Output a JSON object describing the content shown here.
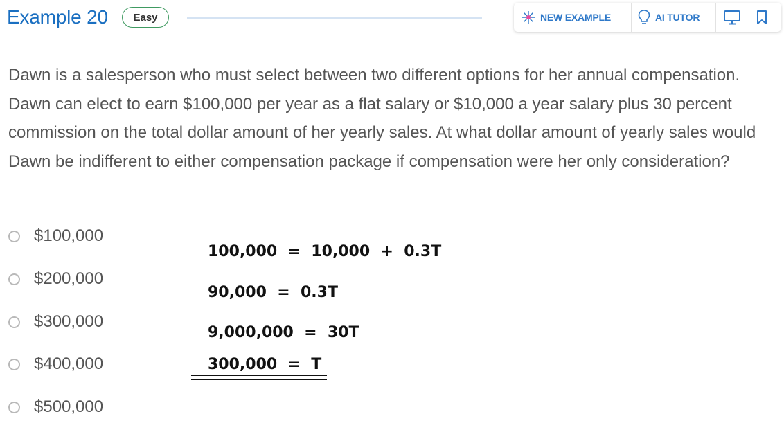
{
  "header": {
    "title": "Example 20",
    "difficulty_badge": "Easy",
    "toolbar": {
      "new_example_label": "NEW EXAMPLE",
      "ai_tutor_label": "AI TUTOR",
      "icons": [
        "sparkle-icon",
        "lightbulb-icon",
        "monitor-icon",
        "bookmark-icon"
      ]
    }
  },
  "question": {
    "text": "Dawn is a salesperson who must select between two different options for her annual compensation. Dawn can elect to earn $100,000 per year as a flat salary or $10,000 a year salary plus 30 percent commission on the total dollar amount of her yearly sales. At what dollar amount of yearly sales would Dawn be indifferent to either compensation package if compensation were her only consideration?"
  },
  "options": [
    {
      "label": "$100,000"
    },
    {
      "label": "$200,000"
    },
    {
      "label": "$300,000"
    },
    {
      "label": "$400,000"
    },
    {
      "label": "$500,000"
    }
  ],
  "work": {
    "line1": "100,000  =  10,000  +  0.3T",
    "line2": "90,000  =  0.3T",
    "line3": "9,000,000  =  30T",
    "line4": "300,000  =  T"
  },
  "colors": {
    "title": "#1a6fc1",
    "accent": "#2f79c9",
    "badge_border": "#3f9a61",
    "body_text": "#555555"
  }
}
